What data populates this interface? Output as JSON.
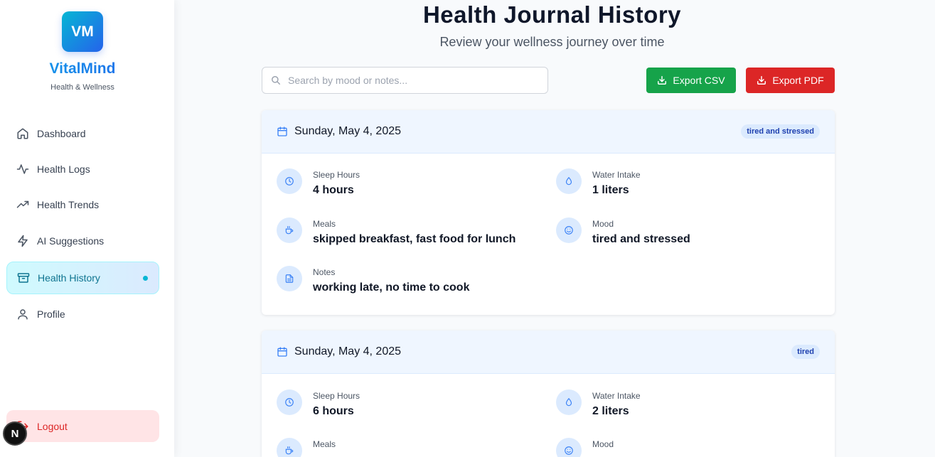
{
  "sidebar": {
    "logo_text": "VM",
    "brand": "VitalMind",
    "tagline": "Health & Wellness",
    "items": [
      {
        "label": "Dashboard",
        "icon": "home-icon"
      },
      {
        "label": "Health Logs",
        "icon": "activity-icon"
      },
      {
        "label": "Health Trends",
        "icon": "trending-up-icon"
      },
      {
        "label": "AI Suggestions",
        "icon": "bolt-icon"
      },
      {
        "label": "Health History",
        "icon": "archive-icon",
        "active": true
      },
      {
        "label": "Profile",
        "icon": "user-icon"
      }
    ],
    "logout_label": "Logout",
    "badge_letter": "N"
  },
  "header": {
    "title": "Health Journal History",
    "subtitle": "Review your wellness journey over time"
  },
  "search": {
    "placeholder": "Search by mood or notes..."
  },
  "toolbar": {
    "export_csv_label": "Export CSV",
    "export_pdf_label": "Export PDF"
  },
  "colors": {
    "accent": "#06b6d4",
    "csv": "#16a34a",
    "pdf": "#dc2626"
  },
  "entries": [
    {
      "date": "Sunday, May 4, 2025",
      "mood_badge": "tired and stressed",
      "sleep_label": "Sleep Hours",
      "sleep_value": "4 hours",
      "water_label": "Water Intake",
      "water_value": "1 liters",
      "meals_label": "Meals",
      "meals_value": "skipped breakfast, fast food for lunch",
      "mood_label": "Mood",
      "mood_value": "tired and stressed",
      "notes_label": "Notes",
      "notes_value": "working late, no time to cook"
    },
    {
      "date": "Sunday, May 4, 2025",
      "mood_badge": "tired",
      "sleep_label": "Sleep Hours",
      "sleep_value": "6 hours",
      "water_label": "Water Intake",
      "water_value": "2 liters",
      "meals_label": "Meals",
      "mood_label": "Mood"
    }
  ]
}
